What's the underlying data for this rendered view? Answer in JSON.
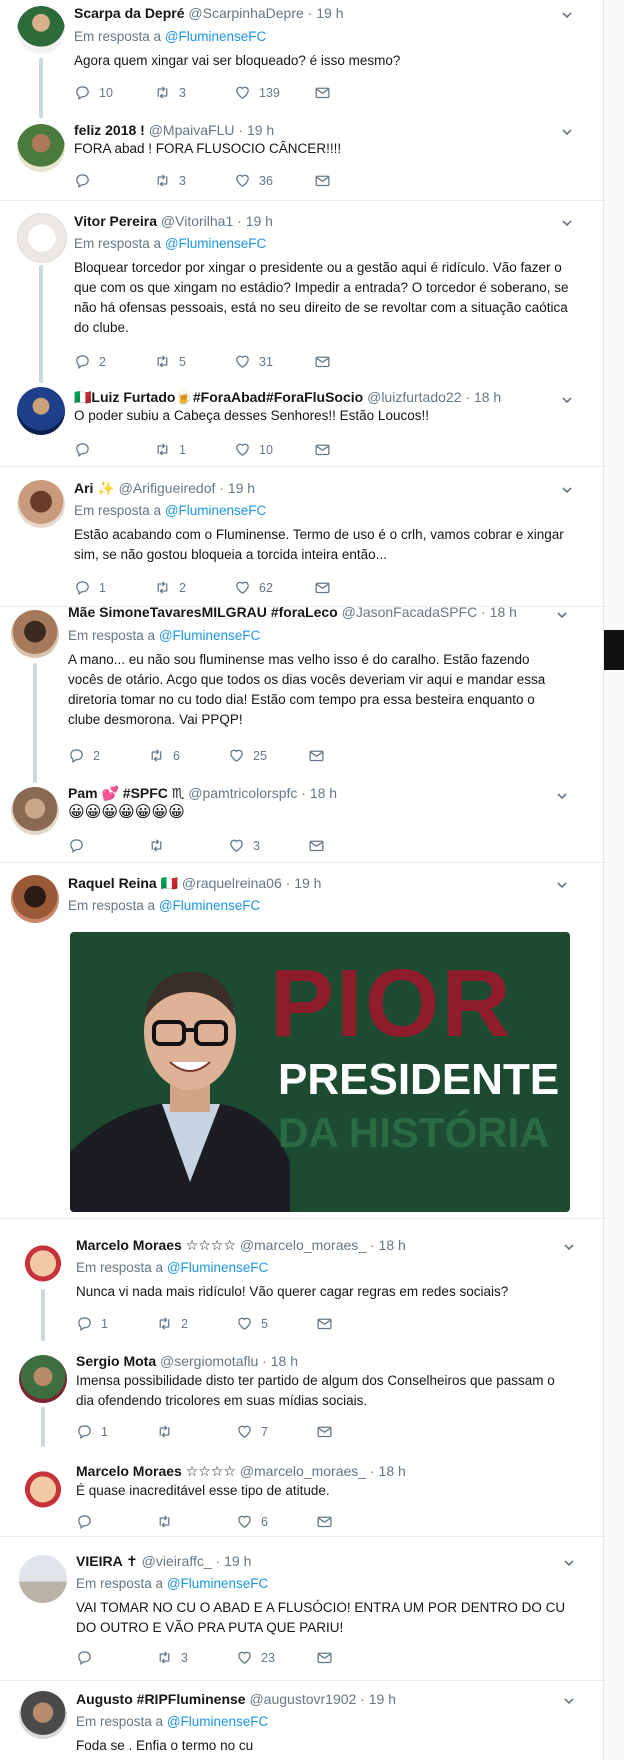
{
  "tweets": [
    {
      "name": "Scarpa da Depré",
      "handle": "@ScarpinhaDepre",
      "time": "19 h",
      "reply_prefix": "Em resposta a",
      "reply_to": "@FluminenseFC",
      "text": "Agora quem xingar vai ser bloqueado? é isso mesmo?",
      "replies": "10",
      "retweets": "3",
      "likes": "139"
    },
    {
      "name": "feliz 2018 !",
      "handle": "@MpaivaFLU",
      "time": "19 h",
      "reply_prefix": "",
      "reply_to": "",
      "text": "FORA abad ! FORA FLUSOCIO CÂNCER!!!!",
      "replies": "",
      "retweets": "3",
      "likes": "36"
    },
    {
      "name": "Vitor Pereira",
      "handle": "@Vitorilha1",
      "time": "19 h",
      "reply_prefix": "Em resposta a",
      "reply_to": "@FluminenseFC",
      "text": "Bloquear torcedor por xingar o presidente ou a gestão aqui é ridículo. Vão fazer o que com os que xingam no estádio? Impedir a entrada? O torcedor é soberano, se não há ofensas pessoais, está no seu direito de se revoltar com a situação caótica do clube.",
      "replies": "2",
      "retweets": "5",
      "likes": "31"
    },
    {
      "name": "🇮🇹Luiz Furtado🍺#ForaAbad#ForaFluSocio",
      "handle": "@luizfurtado22",
      "time": "18 h",
      "reply_prefix": "",
      "reply_to": "",
      "text": "O poder subiu a Cabeça desses Senhores!! Estão Loucos!!",
      "replies": "",
      "retweets": "1",
      "likes": "10"
    },
    {
      "name": "Ari ✨",
      "handle": "@Arifigueiredof",
      "time": "19 h",
      "reply_prefix": "Em resposta a",
      "reply_to": "@FluminenseFC",
      "text": "Estão acabando com o Fluminense. Termo de uso é o crlh, vamos cobrar e xingar sim, se não gostou bloqueia a torcida inteira então...",
      "replies": "1",
      "retweets": "2",
      "likes": "62"
    },
    {
      "name": "Mãe SimoneTavaresMILGRAU #foraLeco",
      "handle": "@JasonFacadaSPFC",
      "time": "18 h",
      "reply_prefix": "Em resposta a",
      "reply_to": "@FluminenseFC",
      "text": "A mano... eu não sou fluminense mas velho isso é do caralho. Estão fazendo vocês de otário. Acgo que todos os dias vocês deveriam vir aqui e mandar essa diretoria tomar no cu todo dia! Estão com tempo pra essa besteira enquanto o clube desmorona. Vai PPQP!",
      "replies": "2",
      "retweets": "6",
      "likes": "25"
    },
    {
      "name": "Pam 💕 #SPFC ♏",
      "handle": "@pamtricolorspfc",
      "time": "18 h",
      "reply_prefix": "",
      "reply_to": "",
      "text": "😀😀😀😀😀😀😀",
      "replies": "",
      "retweets": "",
      "likes": "3"
    },
    {
      "name": "Raquel Reina 🇮🇹",
      "handle": "@raquelreina06",
      "time": "19 h",
      "reply_prefix": "Em resposta a",
      "reply_to": "@FluminenseFC",
      "text": "",
      "replies": "",
      "retweets": "",
      "likes": ""
    },
    {
      "name": "Marcelo Moraes ☆☆☆☆",
      "handle": "@marcelo_moraes_",
      "time": "18 h",
      "reply_prefix": "Em resposta a",
      "reply_to": "@FluminenseFC",
      "text": "Nunca vi nada mais ridículo! Vão querer cagar regras em redes sociais?",
      "replies": "1",
      "retweets": "2",
      "likes": "5"
    },
    {
      "name": "Sergio Mota",
      "handle": "@sergiomotaflu",
      "time": "18 h",
      "reply_prefix": "",
      "reply_to": "",
      "text": "Imensa possibilidade disto ter partido de algum dos Conselheiros que passam o dia ofendendo tricolores em suas mídias sociais.",
      "replies": "1",
      "retweets": "",
      "likes": "7"
    },
    {
      "name": "Marcelo Moraes ☆☆☆☆",
      "handle": "@marcelo_moraes_",
      "time": "18 h",
      "reply_prefix": "",
      "reply_to": "",
      "text": "É quase inacreditável esse tipo de atitude.",
      "replies": "",
      "retweets": "",
      "likes": "6"
    },
    {
      "name": "VIEIRA ✝",
      "handle": "@vieiraffc_",
      "time": "19 h",
      "reply_prefix": "Em resposta a",
      "reply_to": "@FluminenseFC",
      "text": "VAI TOMAR NO CU O ABAD E A FLUSÓCIO! ENTRA UM POR DENTRO DO CU DO OUTRO E VÃO PRA PUTA QUE PARIU!",
      "replies": "",
      "retweets": "3",
      "likes": "23"
    },
    {
      "name": "Augusto #RIPFluminense",
      "handle": "@augustovr1902",
      "time": "19 h",
      "reply_prefix": "Em resposta a",
      "reply_to": "@FluminenseFC",
      "text": "Foda se . Enfia o termo no cu",
      "replies": "",
      "retweets": "",
      "likes": ""
    }
  ],
  "media": {
    "line1": "PIOR",
    "line2": "PRESIDENTE",
    "line3": "DA HISTÓRIA"
  },
  "dot": "·",
  "colors": {
    "link": "#1b95e0",
    "muted": "#657786",
    "media_bg": "#1d4b31",
    "pior": "#8e1c2a"
  },
  "icons": [
    "reply-icon",
    "retweet-icon",
    "like-icon",
    "message-icon",
    "chevron-down-icon"
  ]
}
